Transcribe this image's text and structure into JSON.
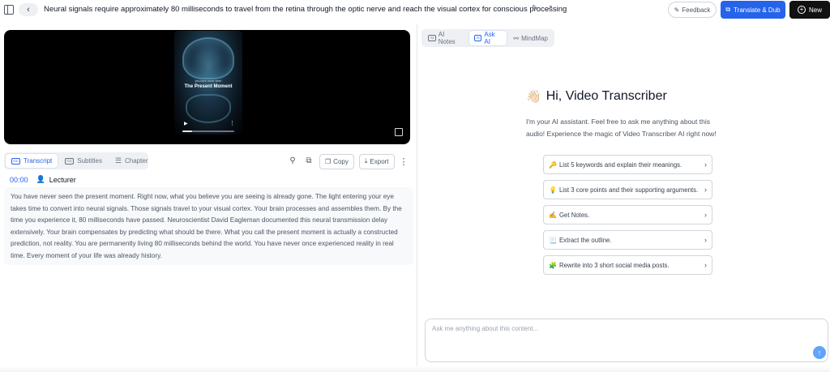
{
  "header": {
    "title": "Neural signals require approximately 80 milliseconds to travel from the retina through the optic nerve and reach the visual cortex for conscious processing",
    "back_glyph": "‹",
    "feedback_label": "Feedback",
    "translate_label": "Translate & Dub",
    "new_label": "New",
    "accent": "#2563eb"
  },
  "video": {
    "thumb_small_text": "you have never seen",
    "thumb_title": "The Present Moment",
    "progress": 0.18
  },
  "left_tabs": [
    {
      "label": "Transcript",
      "active": true
    },
    {
      "label": "Subtitles",
      "active": false
    },
    {
      "label": "Chapter",
      "active": false
    }
  ],
  "tools": {
    "copy_label": "Copy",
    "export_label": "Export"
  },
  "transcript": {
    "timestamp": "00:00",
    "speaker": "Lecturer",
    "text": "You have never seen the present moment. Right now, what you believe you are seeing is already gone. The light entering your eye takes time to convert into neural signals. Those signals travel to your visual cortex. Your brain processes and assembles them. By the time you experience it, 80 milliseconds have passed. Neuroscientist David Eagleman documented this neural transmission delay extensively. Your brain compensates by predicting what should be there. What you call the present moment is actually a constructed prediction, not reality. You are permanently living 80 milliseconds behind the world. You have never once experienced reality in real time. Every moment of your life was already history."
  },
  "right_tabs": [
    {
      "label": "AI Notes",
      "active": false
    },
    {
      "label": "Ask AI",
      "active": true
    },
    {
      "label": "MindMap",
      "active": false
    }
  ],
  "assistant": {
    "wave": "👋🏻",
    "greeting": "Hi, Video Transcriber",
    "intro": "I'm your AI assistant. Feel free to ask me anything about this audio! Experience the magic of Video Transcriber AI right now!",
    "suggestions": [
      {
        "emoji": "🔑",
        "label": "List 5 keywords and explain their meanings."
      },
      {
        "emoji": "💡",
        "label": "List 3 core points and their supporting arguments."
      },
      {
        "emoji": "✍️",
        "label": "Get Notes."
      },
      {
        "emoji": "📃",
        "label": "Extract the outline."
      },
      {
        "emoji": "🧩",
        "label": "Rewrite into 3 short social media posts."
      }
    ],
    "input_placeholder": "Ask me anything about this content...",
    "input_value": ""
  }
}
